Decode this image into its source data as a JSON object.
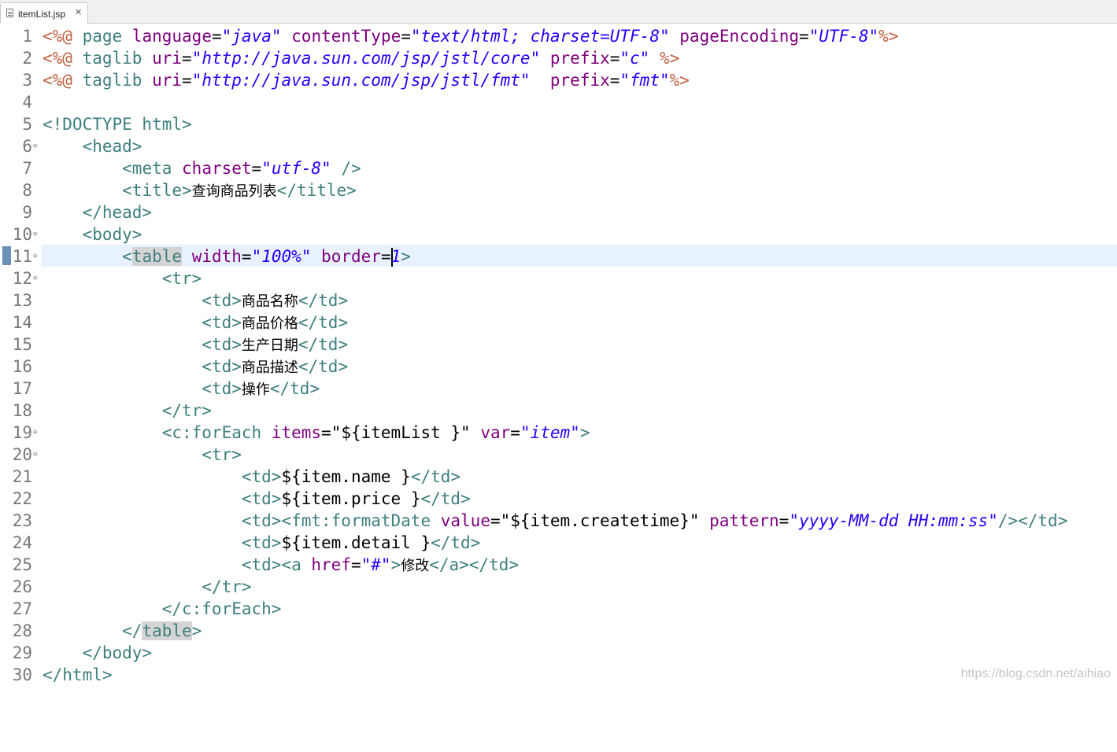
{
  "tab": {
    "label": "itemList.jsp"
  },
  "gutter": {
    "numbers": [
      "1",
      "2",
      "3",
      "4",
      "5",
      "6",
      "7",
      "8",
      "9",
      "10",
      "11",
      "12",
      "13",
      "14",
      "15",
      "16",
      "17",
      "18",
      "19",
      "20",
      "21",
      "22",
      "23",
      "24",
      "25",
      "26",
      "27",
      "28",
      "29",
      "30"
    ]
  },
  "code": {
    "title_text": "查询商品列表",
    "col_names": [
      "商品名称",
      "商品价格",
      "生产日期",
      "商品描述",
      "操作"
    ],
    "edit_link": "修改"
  },
  "watermark": "https://blog.csdn.net/aihiao",
  "colors": {
    "tag": "#3f7f7f",
    "attribute": "#7f007f",
    "value": "#2a00ff",
    "jsp": "#bf5f3f",
    "current_line": "#e8f2fe"
  }
}
